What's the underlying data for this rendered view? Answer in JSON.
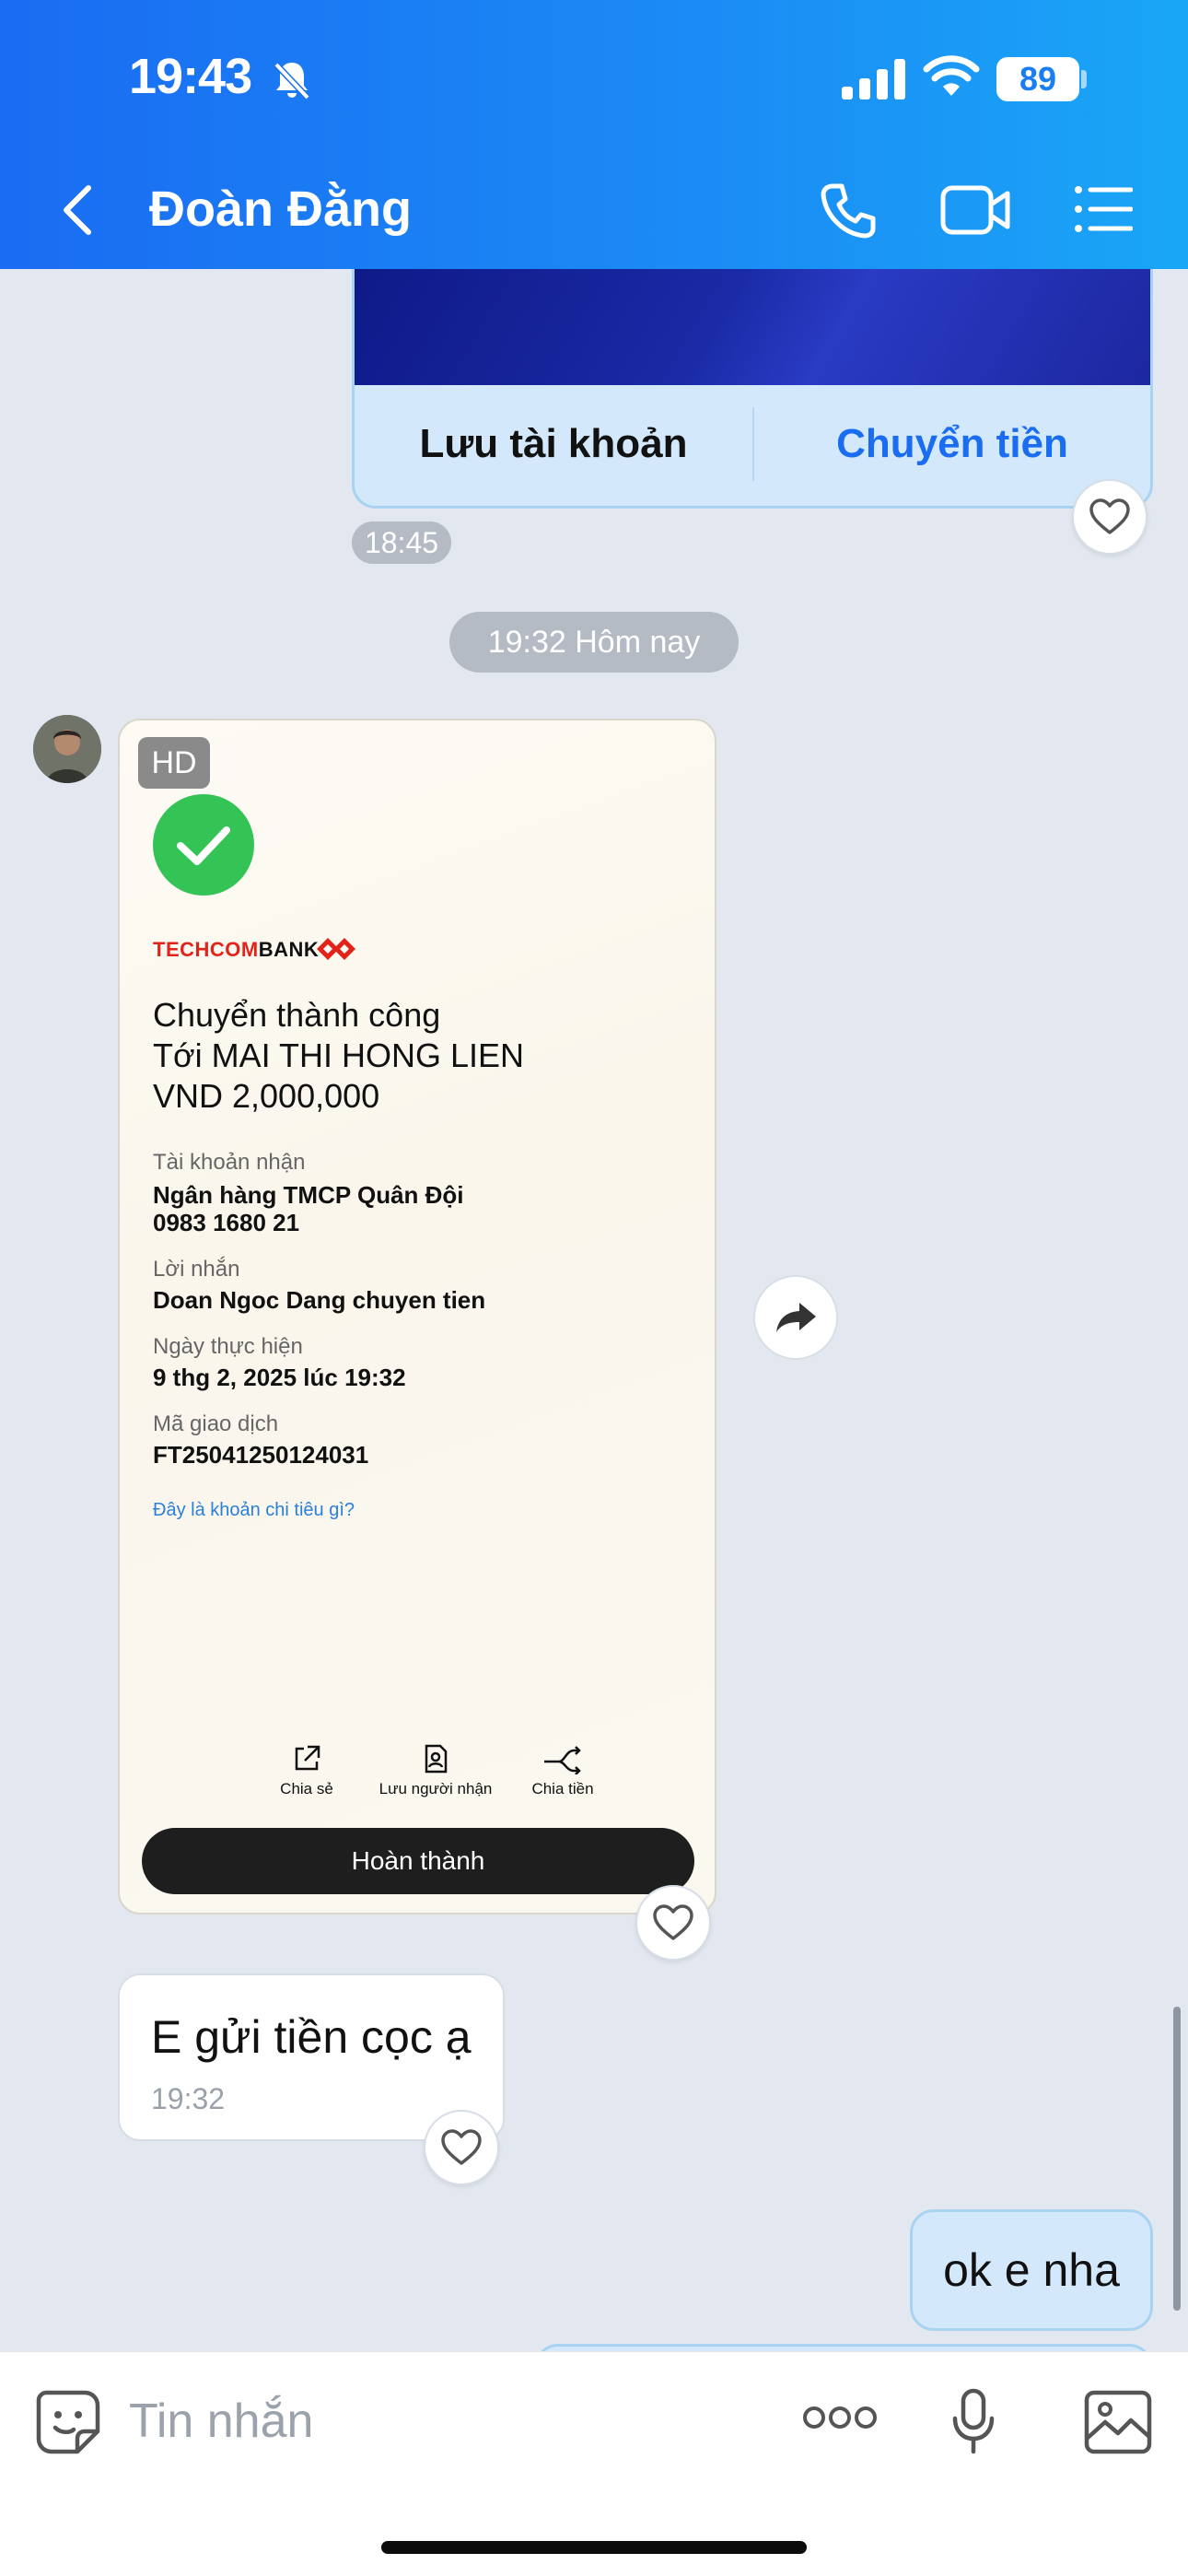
{
  "status_bar": {
    "time": "19:43",
    "battery": "89",
    "icons": [
      "bell-slash-icon",
      "cellular-signal-icon",
      "wifi-icon",
      "battery-icon"
    ]
  },
  "header": {
    "contact_name": "Đoàn Đằng",
    "icons": [
      "back-chevron-icon",
      "phone-icon",
      "video-call-icon",
      "list-menu-icon"
    ]
  },
  "account_card": {
    "save_label": "Lưu tài khoản",
    "transfer_label": "Chuyển tiền",
    "time": "18:45"
  },
  "date_divider": "19:32 Hôm nay",
  "receipt_image": {
    "hd_badge": "HD",
    "bank_logo_red": "TECHCOM",
    "bank_logo_black": "BANK",
    "status_line": "Chuyển thành công",
    "recipient_line": "Tới MAI THI HONG LIEN",
    "amount_line": "VND 2,000,000",
    "receiving_account_label": "Tài khoản nhận",
    "receiving_bank": "Ngân hàng TMCP Quân Đội",
    "receiving_account_number": "0983 1680 21",
    "message_label": "Lời nhắn",
    "message_value": "Doan Ngoc Dang chuyen tien",
    "date_label": "Ngày thực hiện",
    "date_value": "9 thg 2, 2025 lúc 19:32",
    "transaction_label": "Mã giao dịch",
    "transaction_value": "FT25041250124031",
    "spending_link": "Đây là khoản chi tiêu gì?",
    "actions": [
      "Chia sẻ",
      "Lưu người nhận",
      "Chia tiền"
    ],
    "done_button": "Hoàn thành"
  },
  "incoming_message": {
    "text": "E gửi tiền cọc ạ",
    "time": "19:32"
  },
  "outgoing_message": {
    "text": "ok e nha"
  },
  "composer": {
    "placeholder": "Tin nhắn",
    "icons": [
      "emoji-sticker-icon",
      "more-dots-icon",
      "microphone-icon",
      "image-gallery-icon"
    ]
  },
  "colors": {
    "header_start": "#1a6cf2",
    "header_end": "#19a6f6",
    "outgoing_bubble": "#d3e9fb",
    "accent_blue": "#1a6df0",
    "success_green": "#34c456",
    "techcombank_red": "#e2231a"
  }
}
